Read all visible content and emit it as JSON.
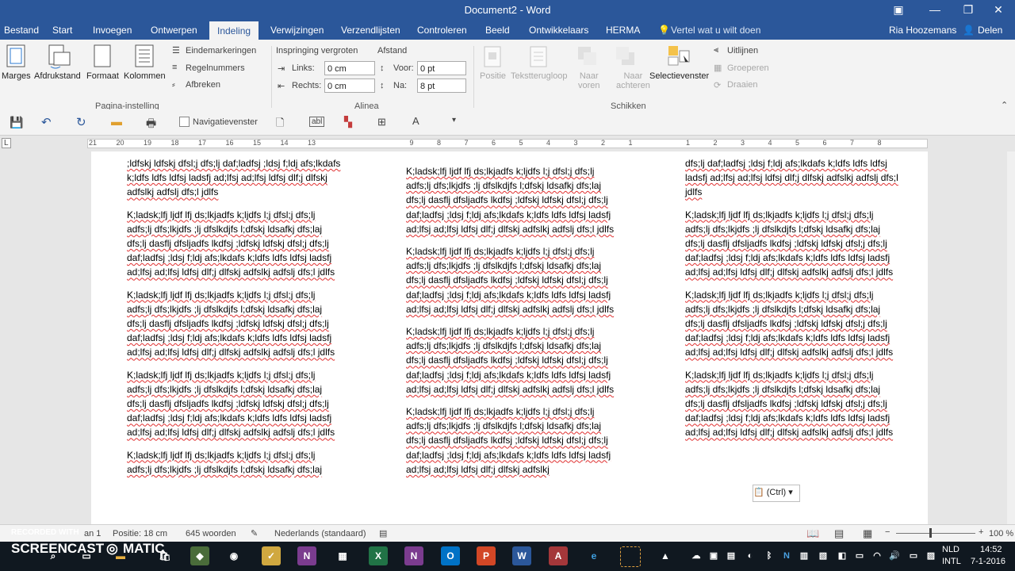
{
  "window": {
    "title": "Document2 - Word",
    "ribbon_display_icon": "ribbon-options-icon",
    "minimize_icon": "minimize-icon",
    "restore_icon": "restore-icon",
    "close_icon": "close-icon"
  },
  "tabs": [
    {
      "label": "Bestand"
    },
    {
      "label": "Start"
    },
    {
      "label": "Invoegen"
    },
    {
      "label": "Ontwerpen"
    },
    {
      "label": "Indeling"
    },
    {
      "label": "Verwijzingen"
    },
    {
      "label": "Verzendlijsten"
    },
    {
      "label": "Controleren"
    },
    {
      "label": "Beeld"
    },
    {
      "label": "Ontwikkelaars"
    },
    {
      "label": "HERMA"
    }
  ],
  "active_tab": "Indeling",
  "tellme": "Vertel wat u wilt doen",
  "user": "Ria Hoozemans",
  "share": "Delen",
  "ribbon": {
    "page_setup": {
      "marges": "Marges",
      "afdrukstand": "Afdrukstand",
      "formaat": "Formaat",
      "kolommen": "Kolommen",
      "eindemarkeringen": "Eindemarkeringen",
      "regelnummers": "Regelnummers",
      "afbreken": "Afbreken",
      "group": "Pagina-instelling"
    },
    "paragraph": {
      "inspringing": "Inspringing vergroten",
      "afstand": "Afstand",
      "links_label": "Links:",
      "links_value": "0 cm",
      "rechts_label": "Rechts:",
      "rechts_value": "0 cm",
      "voor_label": "Voor:",
      "voor_value": "0 pt",
      "na_label": "Na:",
      "na_value": "8 pt",
      "group": "Alinea"
    },
    "arrange": {
      "positie": "Positie",
      "tekstterugloop": "Tekstterugloop",
      "naar_voren_1": "Naar",
      "naar_voren_2": "voren",
      "naar_achteren_1": "Naar",
      "naar_achteren_2": "achteren",
      "selectievenster": "Selectievenster",
      "uitlijnen": "Uitlijnen",
      "groeperen": "Groeperen",
      "draaien": "Draaien",
      "group": "Schikken"
    }
  },
  "qat": {
    "navigatievenster": "Navigatievenster"
  },
  "ruler_numbers": [
    "21",
    "20",
    "19",
    "18",
    "17",
    "16",
    "15",
    "14",
    "13",
    "9",
    "8",
    "7",
    "6",
    "5",
    "4",
    "3",
    "2",
    "1",
    "1",
    "2",
    "3",
    "4",
    "5",
    "6",
    "7",
    "8"
  ],
  "document": {
    "col1_top": ";ldfskj ldfskj dfsl;j dfs;lj daf;ladfsj ;ldsj f;ldj afs;lkdafs k;ldfs ldfs ldfsj ladsfj ad;lfsj ad;lfsj ldfsj dlf;j dlfskj adfslkj adfslj dfs;l jdlfs",
    "col2_top": "K;ladsk;lfj ljdf lfj ds;lkjadfs k;ljdfs l;j dfsl;j dfs;lj adfs;lj dfs;lkjdfs ;lj dfslkdjfs l;dfskj ldsafkj dfs;laj dfs;lj dasflj dfsljadfs lkdfsj ;ldfskj ldfskj dfsl;j dfs;lj daf;ladfsj ;ldsj f;ldj afs;lkdafs k;ldfs ldfs ldfsj ladsfj ad;lfsj ad;lfsj ldfsj dlf;j dlfskj adfslkj adfslj dfs;l jdlfs",
    "col3_top": "dfs;lj daf;ladfsj ;ldsj f;ldj afs;lkdafs k;ldfs ldfs ldfsj ladsfj ad;lfsj ad;lfsj ldfsj dlf;j dlfskj adfslkj adfslj dfs;l jdlfs",
    "para": "K;ladsk;lfj ljdf lfj ds;lkjadfs k;ljdfs l;j dfsl;j dfs;lj adfs;lj dfs;lkjdfs ;lj dfslkdjfs l;dfskj ldsafkj dfs;laj dfs;lj dasflj dfsljadfs lkdfsj ;ldfskj ldfskj dfsl;j dfs;lj daf;ladfsj ;ldsj f;ldj afs;lkdafs k;ldfs ldfs ldfsj ladsfj ad;lfsj ad;lfsj ldfsj dlf;j dlfskj adfslkj adfslj dfs;l jdlfs",
    "para_partial": "K;ladsk;lfj ljdf lfj ds;lkjadfs k;ljdfs l;j dfsl;j dfs;lj adfs;lj dfs;lkjdfs ;lj dfslkdjfs l;dfskj ldsafkj dfs;laj",
    "col2_bottom": "K;ladsk;lfj ljdf lfj ds;lkjadfs k;ljdfs l;j dfsl;j dfs;lj adfs;lj dfs;lkjdfs ;lj dfslkdjfs l;dfskj ldsafkj dfs;laj dfs;lj dasflj dfsljadfs lkdfsj ;ldfskj ldfskj dfsl;j dfs;lj daf;ladfsj ;ldsj f;ldj afs;lkdafs k;ldfs ldfs ldfsj ladsfj ad;lfsj ad;lfsj ldfsj dlf;j dlfskj adfslkj",
    "paste_options": "(Ctrl)"
  },
  "status": {
    "page": "an 1",
    "positie": "Positie: 18 cm",
    "words": "645 woorden",
    "language": "Nederlands (standaard)",
    "zoom": "100 %"
  },
  "watermark": {
    "line1": "RECORDED WITH",
    "line2": "SCREENCAST",
    "line3": "MATIC"
  },
  "taskbar": {
    "lang1": "NLD",
    "lang2": "INTL",
    "time": "14:52",
    "date": "7-1-2016"
  },
  "colors": {
    "word_blue": "#2b579a",
    "ribbon_bg": "#f3f3f3",
    "spell_red": "#e03030"
  }
}
